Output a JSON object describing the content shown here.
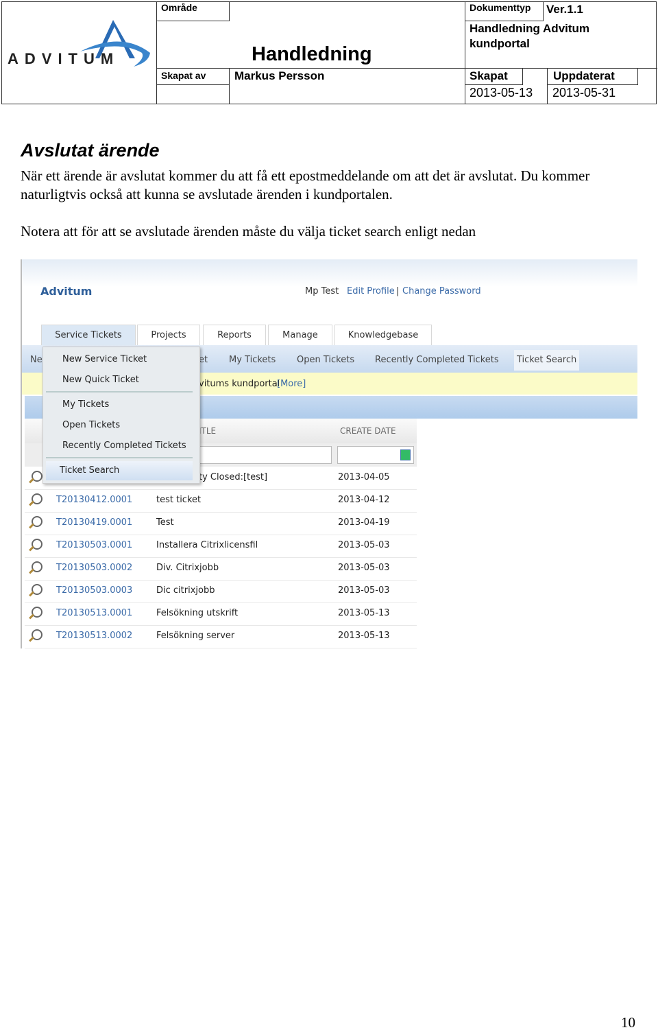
{
  "header": {
    "logo_text": "ADVITUM",
    "area_label": "Område",
    "title": "Handledning",
    "doctype_label": "Dokumenttyp",
    "version": "Ver.1.1",
    "doctype_value": "Handledning Advitum kundportal",
    "created_by_label": "Skapat av",
    "created_by": "Markus Persson",
    "created_label": "Skapat",
    "updated_label": "Uppdaterat",
    "created_date": "2013-05-13",
    "updated_date": "2013-05-31"
  },
  "body": {
    "heading": "Avslutat ärende",
    "para1": "När ett ärende är avslutat kommer du att få ett epostmeddelande om att det är avslutat. Du kommer naturligtvis också att kunna se avslutade ärenden i kundportalen.",
    "para2": "Notera att för att se avslutade ärenden måste du välja ticket search enligt nedan"
  },
  "screenshot": {
    "brand": "Advitum",
    "user": "Mp Test",
    "edit_profile": "Edit Profile",
    "separator": "|",
    "change_password": "Change Password",
    "tabs": [
      "Service Tickets",
      "Projects",
      "Reports",
      "Manage",
      "Knowledgebase"
    ],
    "subnav": {
      "partial_left": "Ne",
      "partial_mid": "et",
      "items": [
        "My Tickets",
        "Open Tickets",
        "Recently Completed Tickets",
        "Ticket Search"
      ]
    },
    "notice_partial": "vitums kundportal",
    "notice_more": "[More]",
    "columns": {
      "title_partial": "ITLE",
      "create_date": "CREATE DATE"
    },
    "dropdown": [
      "New Service Ticket",
      "New Quick Ticket",
      "My Tickets",
      "Open Tickets",
      "Recently Completed Tickets",
      "Ticket Search"
    ],
    "first_row": {
      "title_partial": "ty Closed:[test]",
      "date": "2013-04-05"
    },
    "rows": [
      {
        "id": "T20130412.0001",
        "title": "test ticket",
        "date": "2013-04-12"
      },
      {
        "id": "T20130419.0001",
        "title": "Test",
        "date": "2013-04-19"
      },
      {
        "id": "T20130503.0001",
        "title": "Installera Citrixlicensfil",
        "date": "2013-05-03"
      },
      {
        "id": "T20130503.0002",
        "title": "Div. Citrixjobb",
        "date": "2013-05-03"
      },
      {
        "id": "T20130503.0003",
        "title": "Dic citrixjobb",
        "date": "2013-05-03"
      },
      {
        "id": "T20130513.0001",
        "title": "Felsökning utskrift",
        "date": "2013-05-13"
      },
      {
        "id": "T20130513.0002",
        "title": "Felsökning server",
        "date": "2013-05-13"
      }
    ]
  },
  "page_number": "10"
}
